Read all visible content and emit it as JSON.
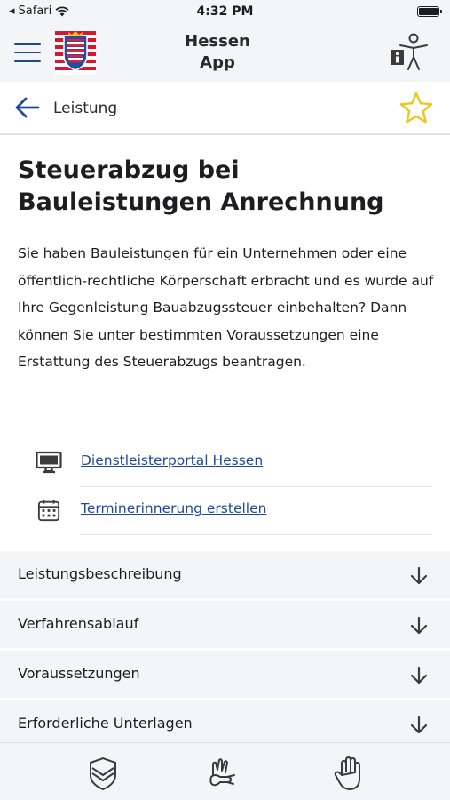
{
  "status_bar": {
    "carrier": "Safari",
    "time": "4:32 PM"
  },
  "header": {
    "title_line1": "Hessen",
    "title_line2": "App"
  },
  "nav": {
    "title": "Leistung"
  },
  "page": {
    "title": "Steuerabzug bei Bauleistungen Anrechnung",
    "description": "Sie haben Bauleistungen für ein Unternehmen oder eine öffentlich-rechtliche Körperschaft erbracht und es wurde auf Ihre Gegenleistung Bauabzugssteuer einbehalten? Dann können Sie unter bestimmten Voraussetzungen eine Erstattung des Steuerabzugs beantragen."
  },
  "links": [
    {
      "label": "Dienstleisterportal Hessen",
      "icon": "monitor-icon"
    },
    {
      "label": "Terminerinnerung erstellen",
      "icon": "calendar-icon"
    }
  ],
  "sections": [
    {
      "label": "Leistungsbeschreibung"
    },
    {
      "label": "Verfahrensablauf"
    },
    {
      "label": "Voraussetzungen"
    },
    {
      "label": "Erforderliche Unterlagen"
    }
  ],
  "tabs": [
    {
      "icon": "hessen-shield-icon"
    },
    {
      "icon": "sign-language-icon"
    },
    {
      "icon": "hand-icon"
    }
  ],
  "colors": {
    "accent": "#1f4a9c",
    "star": "#f0c419",
    "background_gray": "#f4f5f6"
  }
}
